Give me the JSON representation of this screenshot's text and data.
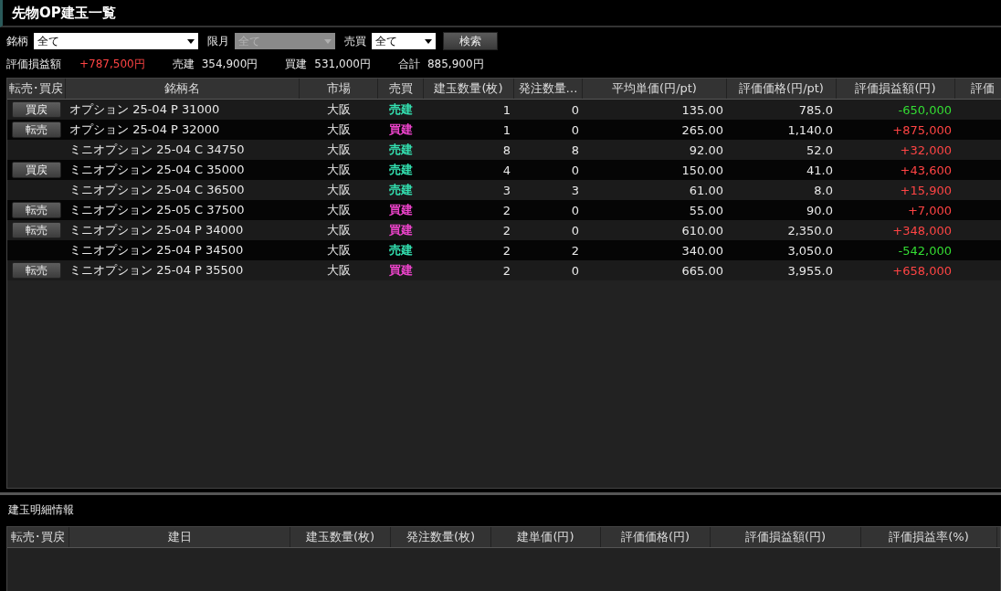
{
  "window": {
    "title": "先物OP建玉一覧"
  },
  "filters": [
    {
      "label": "銘柄",
      "value": "全て",
      "disabled": false
    },
    {
      "label": "限月",
      "value": "全て",
      "disabled": true
    },
    {
      "label": "売買",
      "value": "全て",
      "disabled": false
    }
  ],
  "search_button": "検索",
  "summary": [
    {
      "label": "評価損益額",
      "value": "+787,500円",
      "color": "#ff4444"
    },
    {
      "label": "売建",
      "value": "354,900円"
    },
    {
      "label": "買建",
      "value": "531,000円"
    },
    {
      "label": "合計",
      "value": "885,900円"
    }
  ],
  "positions_table": {
    "columns": [
      "転売･買戻",
      "銘柄名",
      "市場",
      "売買",
      "建玉数量(枚)",
      "発注数量…",
      "平均単価(円/pt)",
      "評価価格(円/pt)",
      "評価損益額(円)",
      "評価"
    ],
    "rows": [
      {
        "action": "買戻",
        "name": "オプション 25-04 P 31000",
        "market": "大阪",
        "side": {
          "text": "売建",
          "color": "#33e0b0"
        },
        "quantity": "1",
        "ordered": "0",
        "average_price": "135.00",
        "valuation_price": "785.0",
        "pnl": {
          "text": "-650,000",
          "color": "#33dd33"
        }
      },
      {
        "action": "転売",
        "name": "オプション 25-04 P 32000",
        "market": "大阪",
        "side": {
          "text": "買建",
          "color": "#ee44cc"
        },
        "quantity": "1",
        "ordered": "0",
        "average_price": "265.00",
        "valuation_price": "1,140.0",
        "pnl": {
          "text": "+875,000",
          "color": "#ff4444"
        }
      },
      {
        "name": "ミニオプション 25-04 C 34750",
        "market": "大阪",
        "side": {
          "text": "売建",
          "color": "#33e0b0"
        },
        "quantity": "8",
        "ordered": "8",
        "average_price": "92.00",
        "valuation_price": "52.0",
        "pnl": {
          "text": "+32,000",
          "color": "#ff4444"
        }
      },
      {
        "action": "買戻",
        "name": "ミニオプション 25-04 C 35000",
        "market": "大阪",
        "side": {
          "text": "売建",
          "color": "#33e0b0"
        },
        "quantity": "4",
        "ordered": "0",
        "average_price": "150.00",
        "valuation_price": "41.0",
        "pnl": {
          "text": "+43,600",
          "color": "#ff4444"
        }
      },
      {
        "name": "ミニオプション 25-04 C 36500",
        "market": "大阪",
        "side": {
          "text": "売建",
          "color": "#33e0b0"
        },
        "quantity": "3",
        "ordered": "3",
        "average_price": "61.00",
        "valuation_price": "8.0",
        "pnl": {
          "text": "+15,900",
          "color": "#ff4444"
        }
      },
      {
        "action": "転売",
        "name": "ミニオプション 25-05 C 37500",
        "market": "大阪",
        "side": {
          "text": "買建",
          "color": "#ee44cc"
        },
        "quantity": "2",
        "ordered": "0",
        "average_price": "55.00",
        "valuation_price": "90.0",
        "pnl": {
          "text": "+7,000",
          "color": "#ff4444"
        }
      },
      {
        "action": "転売",
        "name": "ミニオプション 25-04 P 34000",
        "market": "大阪",
        "side": {
          "text": "買建",
          "color": "#ee44cc"
        },
        "quantity": "2",
        "ordered": "0",
        "average_price": "610.00",
        "valuation_price": "2,350.0",
        "pnl": {
          "text": "+348,000",
          "color": "#ff4444"
        }
      },
      {
        "name": "ミニオプション 25-04 P 34500",
        "market": "大阪",
        "side": {
          "text": "売建",
          "color": "#33e0b0"
        },
        "quantity": "2",
        "ordered": "2",
        "average_price": "340.00",
        "valuation_price": "3,050.0",
        "pnl": {
          "text": "-542,000",
          "color": "#33dd33"
        }
      },
      {
        "action": "転売",
        "name": "ミニオプション 25-04 P 35500",
        "market": "大阪",
        "side": {
          "text": "買建",
          "color": "#ee44cc"
        },
        "quantity": "2",
        "ordered": "0",
        "average_price": "665.00",
        "valuation_price": "3,955.0",
        "pnl": {
          "text": "+658,000",
          "color": "#ff4444"
        }
      }
    ]
  },
  "detail": {
    "title": "建玉明細情報",
    "columns": [
      "転売･買戻",
      "建日",
      "建玉数量(枚)",
      "発注数量(枚)",
      "建単価(円)",
      "評価価格(円)",
      "評価損益額(円)",
      "評価損益率(%)"
    ]
  }
}
